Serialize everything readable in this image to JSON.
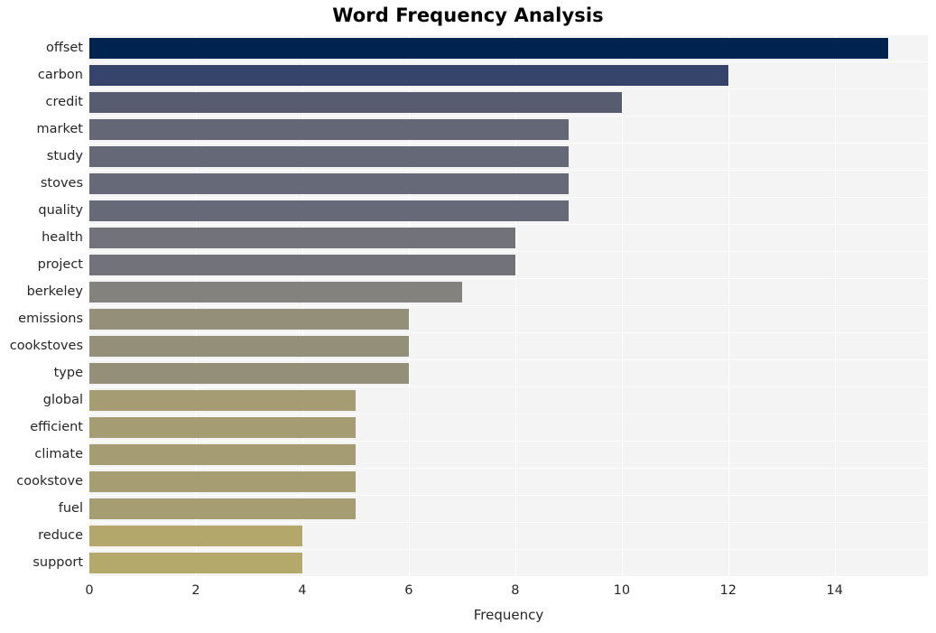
{
  "chart_data": {
    "type": "bar",
    "orientation": "horizontal",
    "title": "Word Frequency Analysis",
    "xlabel": "Frequency",
    "ylabel": "",
    "categories": [
      "offset",
      "carbon",
      "credit",
      "market",
      "study",
      "stoves",
      "quality",
      "health",
      "project",
      "berkeley",
      "emissions",
      "cookstoves",
      "type",
      "global",
      "efficient",
      "climate",
      "cookstove",
      "fuel",
      "reduce",
      "support"
    ],
    "values": [
      15,
      12,
      10,
      9,
      9,
      9,
      9,
      8,
      8,
      7,
      6,
      6,
      6,
      5,
      5,
      5,
      5,
      5,
      4,
      4
    ],
    "xticks": [
      0,
      2,
      4,
      6,
      8,
      10,
      12,
      14
    ],
    "xtick_labels": [
      "0",
      "2",
      "4",
      "6",
      "8",
      "10",
      "12",
      "14"
    ],
    "xlim": [
      0,
      15.75
    ],
    "grid": true,
    "legend": null,
    "bar_colors": [
      "#00234f",
      "#36436b",
      "#575c70",
      "#646776",
      "#656877",
      "#666978",
      "#666978",
      "#71727a",
      "#72737a",
      "#83827c",
      "#938f79",
      "#948f79",
      "#948f79",
      "#a59c73",
      "#a59c73",
      "#a59c73",
      "#a69d73",
      "#a69d73",
      "#b3a76b",
      "#b4a86b"
    ],
    "plot_background": "#f4f4f5",
    "grid_color": "#ffffff",
    "text_color": "#262626"
  }
}
